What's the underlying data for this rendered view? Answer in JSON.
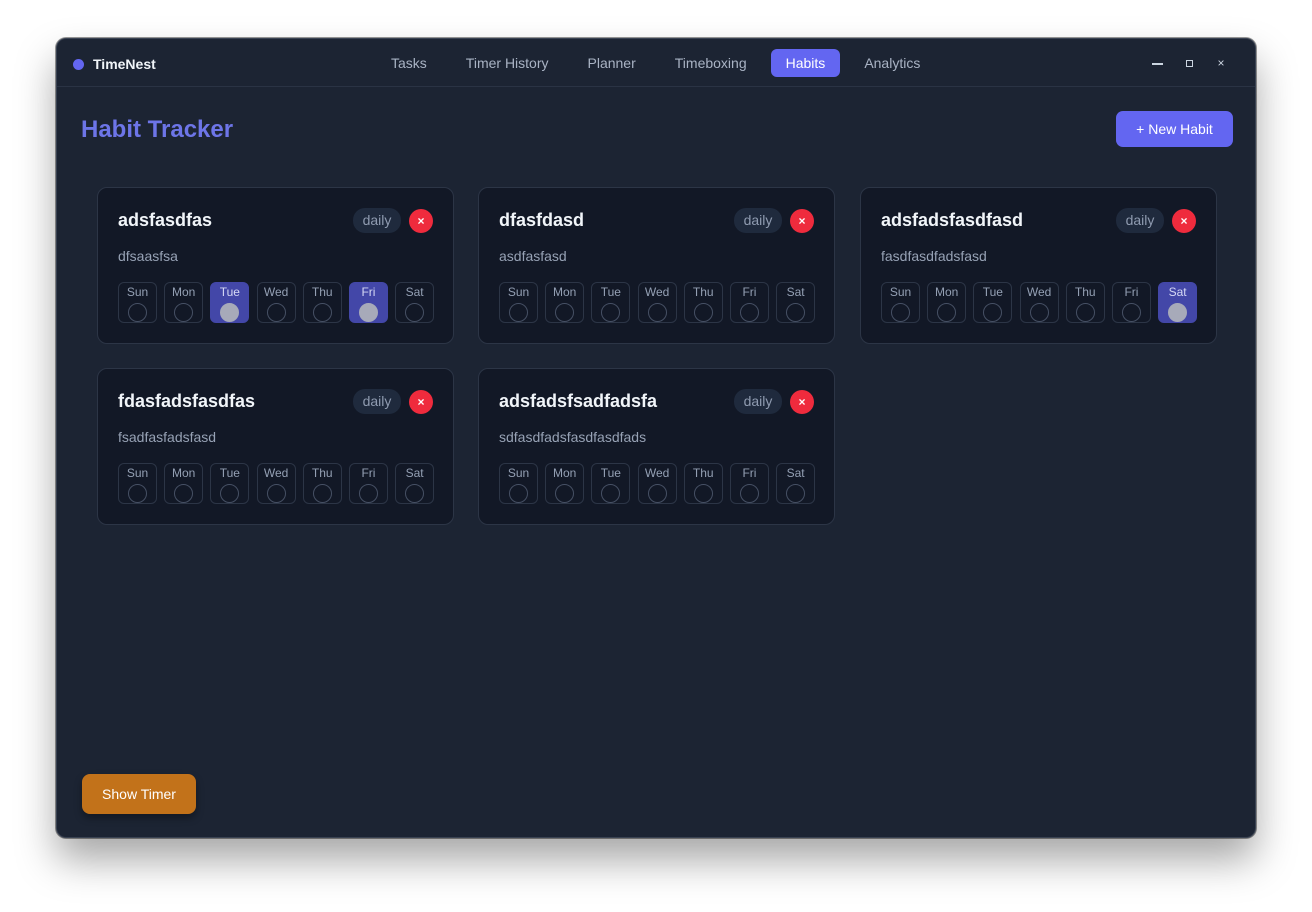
{
  "app": {
    "name": "TimeNest",
    "accent": "#6366f1"
  },
  "nav": {
    "tabs": [
      {
        "label": "Tasks",
        "active": false
      },
      {
        "label": "Timer History",
        "active": false
      },
      {
        "label": "Planner",
        "active": false
      },
      {
        "label": "Timeboxing",
        "active": false
      },
      {
        "label": "Habits",
        "active": true
      },
      {
        "label": "Analytics",
        "active": false
      }
    ]
  },
  "window_controls": {
    "close": "×"
  },
  "page": {
    "title": "Habit Tracker",
    "new_habit_label": "+ New Habit"
  },
  "day_labels": [
    "Sun",
    "Mon",
    "Tue",
    "Wed",
    "Thu",
    "Fri",
    "Sat"
  ],
  "habits": [
    {
      "name": "adsfasdfas",
      "frequency": "daily",
      "delete": "×",
      "description": "dfsaasfsa",
      "checked": [
        false,
        false,
        true,
        false,
        false,
        true,
        false
      ]
    },
    {
      "name": "dfasfdasd",
      "frequency": "daily",
      "delete": "×",
      "description": "asdfasfasd",
      "checked": [
        false,
        false,
        false,
        false,
        false,
        false,
        false
      ]
    },
    {
      "name": "adsfadsfasdfasd",
      "frequency": "daily",
      "delete": "×",
      "description": "fasdfasdfadsfasd",
      "checked": [
        false,
        false,
        false,
        false,
        false,
        false,
        true
      ]
    },
    {
      "name": "fdasfadsfasdfas",
      "frequency": "daily",
      "delete": "×",
      "description": "fsadfasfadsfasd",
      "checked": [
        false,
        false,
        false,
        false,
        false,
        false,
        false
      ]
    },
    {
      "name": "adsfadsfsadfadsfa",
      "frequency": "daily",
      "delete": "×",
      "description": "sdfasdfadsfasdfasdfads",
      "checked": [
        false,
        false,
        false,
        false,
        false,
        false,
        false
      ]
    }
  ],
  "footer": {
    "show_timer_label": "Show Timer"
  },
  "colors": {
    "delete": "#ef2b3d",
    "show_timer": "#c2721a",
    "checked_day": "#4347a8"
  }
}
